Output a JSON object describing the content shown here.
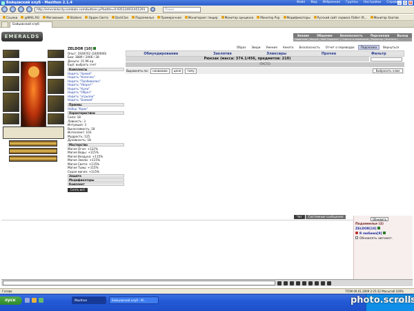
{
  "browser": {
    "title": "Бойцовский клуб - Maxthon 2.1.4",
    "menus": [
      "Файл",
      "Вид",
      "Избранное",
      "Группы",
      "Настройки",
      "Справка"
    ],
    "url": "http://emeraldscity.combats.com/buttons.pl?battle=0.935124911451291",
    "search_placeholder": "Поиск"
  },
  "bookmarks": [
    "Ссылки",
    "@MAIL.RU",
    "Мегамания",
    "Stalkers",
    "Орден Света",
    "DarkClan",
    "Подземелья",
    "Примерочная",
    "Мониторинг пещер",
    "Монитор аукциона",
    "Монитор Pvp",
    "Модификаторы",
    "Русский сайт сервиса Побег (R...",
    "Монитор Хаотов"
  ],
  "tab": {
    "label": "Бойцовский клуб"
  },
  "game": {
    "logo": "EMERALDS",
    "topmenu": [
      "Знание",
      "Общение",
      "Безопасность",
      "Персонажи",
      "Выход"
    ],
    "topmenu2": "Новичкам | Форум | Мой Паролист | Ответы и переписка | Редактор | Болтать |",
    "subnav": [
      "Образ",
      "Звери",
      "Умения",
      "Анкета",
      "Безопасность",
      "Отчет о переводах",
      "Подсказка",
      "Вернуться"
    ],
    "shoptabs": [
      "Обмундирование",
      "Заклятия",
      "Эликсиры",
      "Прочее",
      "Фильтр"
    ],
    "backpack": "Рюкзак (масса: 374.1/456, предметов: 210)",
    "empty": "ПУСТО",
    "align_label": "Выровнять по:",
    "align_buttons": [
      "названию",
      "цене",
      "типу"
    ],
    "throw_all": "Выбросить хлам"
  },
  "character": {
    "name": "ZELDOR",
    "level": "[10]",
    "lines": [
      "Опыт: 1928702 (2400000)",
      "Бои: 3889 / 2466 / 28",
      "Деньги: 11.96 кр.",
      "Ещё: выбрать счет"
    ],
    "sections": [
      "Комплекты",
      "Характеристики",
      "Модификаторы",
      "Защита",
      "Комплект"
    ],
    "sets": [
      "Надеть \"Армия\"",
      "Надеть \"Колечко\"",
      "Надеть \"Пробивалка\"",
      "Надеть \"Уворот\"",
      "Надеть \"Кули\"",
      "Надеть \"Обрез\"",
      "Надеть \"огрызок\"",
      "Надеть \"Боевой\""
    ],
    "skills": [
      "Сила: 18",
      "Ловкость: 3",
      "Интуиция: 3",
      "Выносливость: 18",
      "Интеллект: 103",
      "Мудрость: 125",
      "Духовность: 18"
    ],
    "mastery": [
      "Мастерство",
      "Магия Огня: +122%",
      "Магия Воды: +115%",
      "Магия Воздуха: +115%",
      "Магия Земли: +115%",
      "Магия Света: +115%",
      "Магия Тьмы: +115%",
      "Серая магия: +115%"
    ],
    "priem": "Приемы",
    "set_name": "Набор \"Крик\"",
    "leave": "Снять всё"
  },
  "chat": {
    "tabs": [
      "Чат",
      "Системные сообщения"
    ],
    "refresh": "Обновить",
    "room": "Подземелье (2)",
    "players": [
      "ZELDOR[10]",
      "Я любима[9]"
    ],
    "autorefresh": "Обновлять автомат."
  },
  "status": {
    "left": "Готово",
    "right": "755M  09.01.2009 2:25:32  Масштаб 100%"
  },
  "taskbar": {
    "start": "пуск",
    "tasks": [
      "Бойцовский клуб - M...",
      "Maxthon"
    ],
    "time": "2:25",
    "date": "09.01.2009"
  },
  "watermark": "photo.scrolls.ru"
}
